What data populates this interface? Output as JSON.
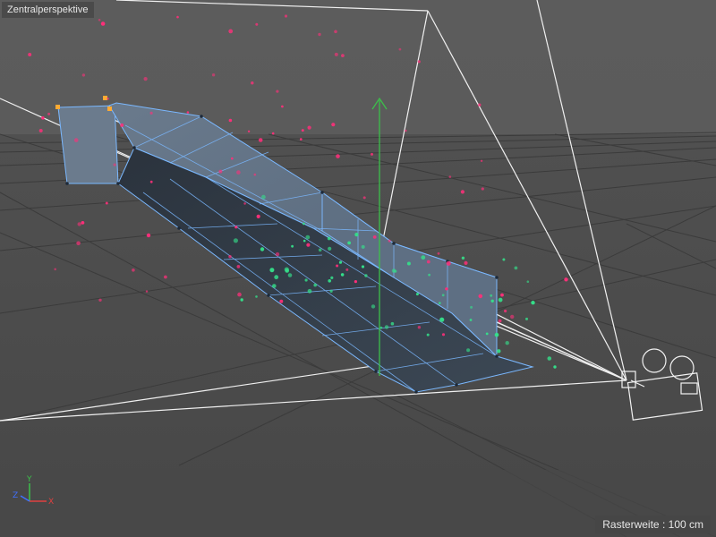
{
  "viewport": {
    "title": "Zentralperspektive",
    "grid_label": "Rasterweite",
    "grid_separator": ":",
    "grid_value": "100 cm"
  },
  "axes": {
    "x": "X",
    "y": "Y",
    "z": "Z"
  },
  "colors": {
    "background": "#595959",
    "floor": "#4b4b4b",
    "grid": "#3a3a3a",
    "mesh_fill": "#4f5e6e",
    "mesh_edge": "#7ab8ff",
    "particle_magenta": "#ff2f7a",
    "particle_green": "#35e08a",
    "selection": "#ffaa33",
    "camera_lines": "#f2f2f2",
    "y_axis": "#3cc04a",
    "x_axis": "#e04040",
    "z_axis": "#4070ff"
  },
  "icons": [
    "camera-object-icon",
    "axis-gizmo-icon",
    "y-axis-arrow-icon"
  ]
}
